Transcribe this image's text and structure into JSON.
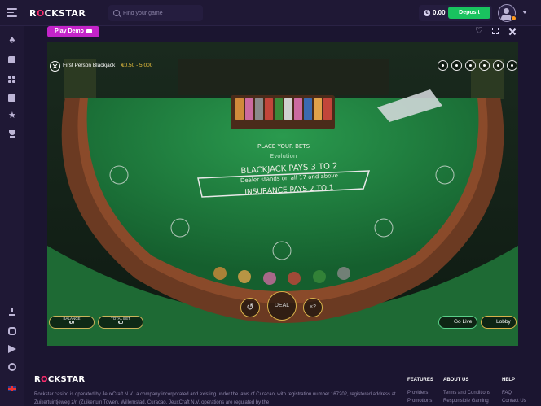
{
  "header": {
    "logo_pre": "R",
    "logo_o": "O",
    "logo_post": "CKSTAR",
    "search_placeholder": "Find your game",
    "balance_currency": "€",
    "balance": "0.00",
    "deposit_label": "Deposit"
  },
  "game_bar": {
    "play_demo_label": "Play Demo"
  },
  "game": {
    "title": "First Person Blackjack",
    "limits": "€0.50 - 5,000",
    "place_bets": "PLACE YOUR BETS",
    "evolution": "Evolution",
    "pays": "BLACKJACK PAYS 3 TO 2",
    "dealer": "Dealer stands on all 17 and above",
    "insurance": "INSURANCE PAYS 2 TO 1",
    "deal_label": "DEAL",
    "double_label": "×2",
    "balance_label": "BALANCE",
    "balance_value": "€0",
    "total_bet_label": "TOTAL BET",
    "total_bet_value": "€0",
    "go_live_label": "Go Live",
    "lobby_label": "Lobby",
    "colors": {
      "felt": "#1f7a3e",
      "rail": "#6b3a22",
      "gold": "#d7b24a"
    }
  },
  "footer": {
    "logo_pre": "R",
    "logo_o": "O",
    "logo_post": "CKSTAR",
    "legal": "Rockstar.casino is operated by JeuxCraft N.V., a company incorporated and existing under the laws of Curacao, with registration number 167202, registered address at Zuikertuintjeweg z/n (Zuikertuin Tower), Willemstad, Curacao. JeuxCraft N.V. operations are regulated by the",
    "columns": [
      {
        "heading": "FEATURES",
        "links": [
          "Providers",
          "Promotions"
        ]
      },
      {
        "heading": "ABOUT US",
        "links": [
          "Terms and Conditions",
          "Responsible Gaming"
        ]
      },
      {
        "heading": "HELP",
        "links": [
          "FAQ",
          "Contact Us"
        ]
      }
    ]
  }
}
